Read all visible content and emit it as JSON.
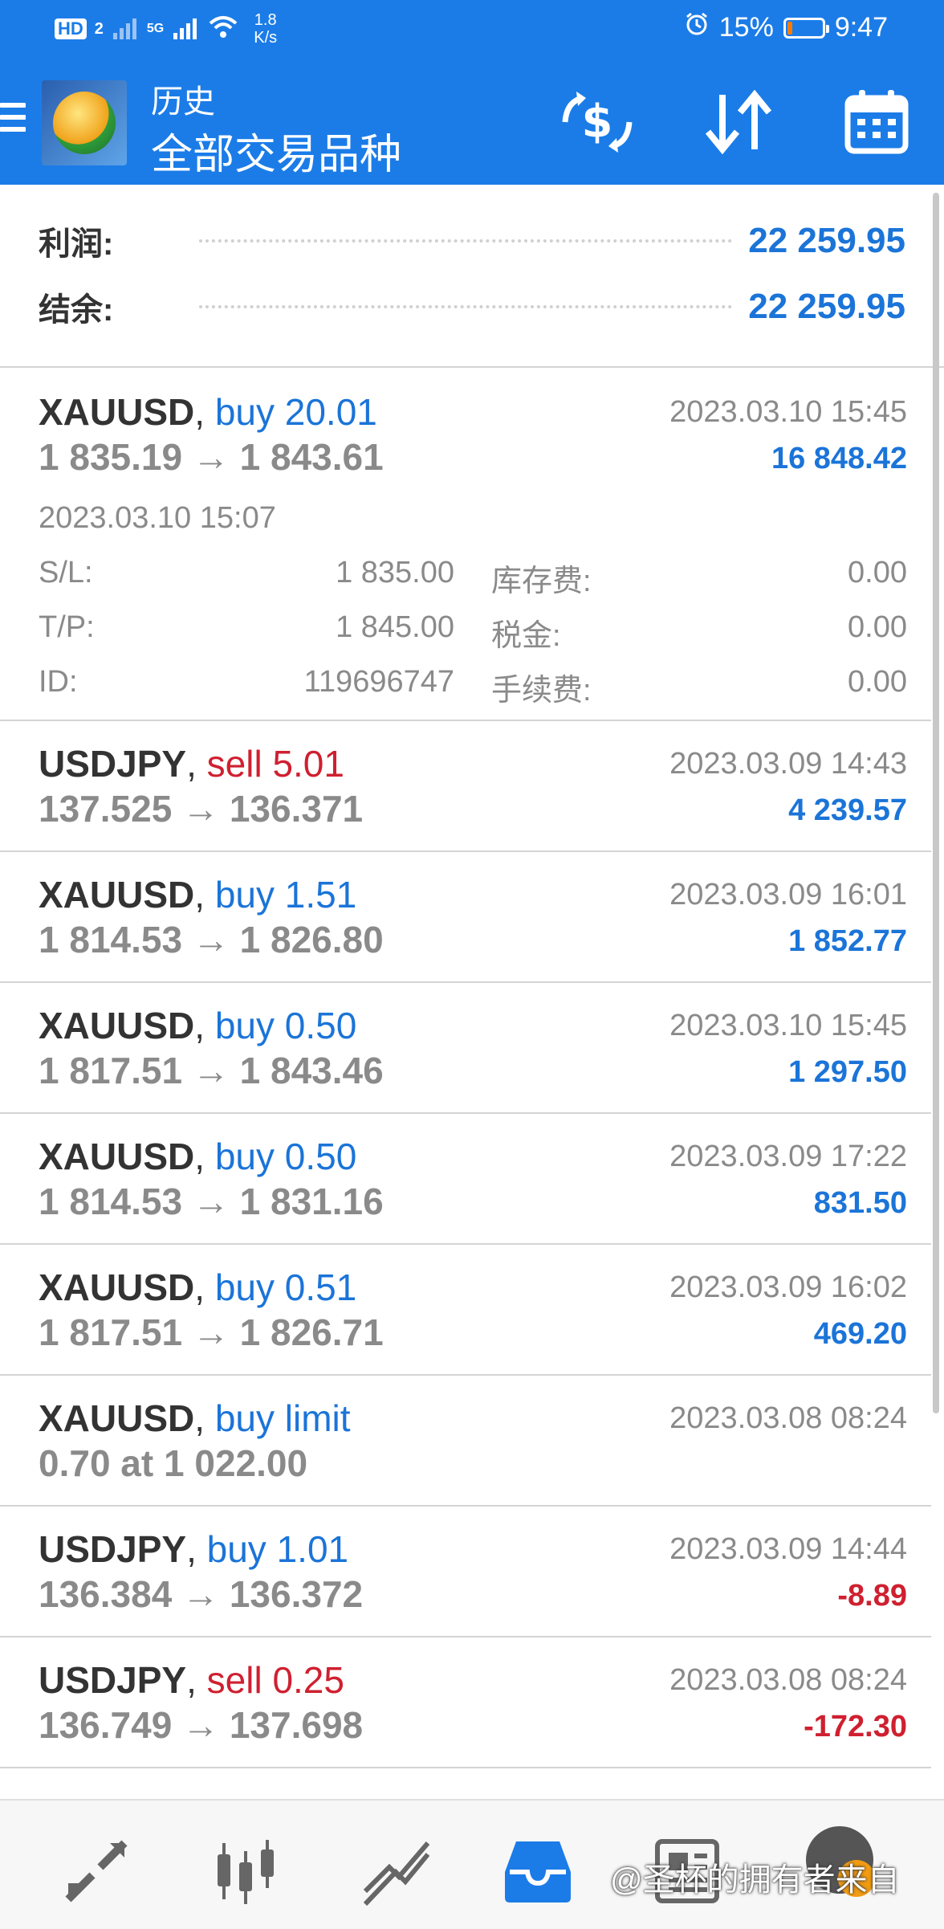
{
  "status_bar": {
    "hd_label": "HD",
    "sim_slot": "2",
    "network": "5G",
    "speed_value": "1.8",
    "speed_unit": "K/s",
    "battery": "15%",
    "battery_level": 0.15,
    "battery_color": "#ff7b00",
    "time": "9:47"
  },
  "app_bar": {
    "title_top": "历史",
    "title_main": "全部交易品种",
    "icons": [
      "hamburger-menu-icon",
      "metatrader-logo",
      "dollar-exchange-icon",
      "sort-icon",
      "calendar-icon"
    ]
  },
  "summary": {
    "profit_label": "利润:",
    "profit_value": "22 259.95",
    "balance_label": "结余:",
    "balance_value": "22 259.95"
  },
  "expanded": {
    "open_time": "2023.03.10 15:07",
    "sl_label": "S/L:",
    "sl_value": "1 835.00",
    "tp_label": "T/P:",
    "tp_value": "1 845.00",
    "id_label": "ID:",
    "id_value": "119696747",
    "swap_label": "库存费:",
    "swap_value": "0.00",
    "tax_label": "税金:",
    "tax_value": "0.00",
    "fee_label": "手续费:",
    "fee_value": "0.00"
  },
  "trades": [
    {
      "symbol": "XAUUSD",
      "side": "buy 20.01",
      "prices": "1 835.19 → 1 843.61",
      "date": "2023.03.10 15:45",
      "profit": "16 848.42"
    },
    {
      "symbol": "USDJPY",
      "side": "sell 5.01",
      "prices": "137.525 → 136.371",
      "date": "2023.03.09 14:43",
      "profit": "4 239.57"
    },
    {
      "symbol": "XAUUSD",
      "side": "buy 1.51",
      "prices": "1 814.53 → 1 826.80",
      "date": "2023.03.09 16:01",
      "profit": "1 852.77"
    },
    {
      "symbol": "XAUUSD",
      "side": "buy 0.50",
      "prices": "1 817.51 → 1 843.46",
      "date": "2023.03.10 15:45",
      "profit": "1 297.50"
    },
    {
      "symbol": "XAUUSD",
      "side": "buy 0.50",
      "prices": "1 814.53 → 1 831.16",
      "date": "2023.03.09 17:22",
      "profit": "831.50"
    },
    {
      "symbol": "XAUUSD",
      "side": "buy 0.51",
      "prices": "1 817.51 → 1 826.71",
      "date": "2023.03.09 16:02",
      "profit": "469.20"
    },
    {
      "symbol": "XAUUSD",
      "side": "buy limit",
      "prices": "0.70 at 1 022.00",
      "date": "2023.03.08 08:24",
      "profit": ""
    },
    {
      "symbol": "USDJPY",
      "side": "buy 1.01",
      "prices": "136.384 → 136.372",
      "date": "2023.03.09 14:44",
      "profit": "-8.89"
    },
    {
      "symbol": "USDJPY",
      "side": "sell 0.25",
      "prices": "136.749 → 137.698",
      "date": "2023.03.08 08:24",
      "profit": "-172.30"
    }
  ],
  "bottom_nav": {
    "icons": [
      "quotes-icon",
      "chart-icon",
      "trade-icon",
      "history-icon",
      "news-icon"
    ],
    "active": "history-icon"
  },
  "watermark": "@圣杯的拥有者来自",
  "colors": {
    "primary": "#1b7ce8",
    "buy_blue": "#1b74d8",
    "sell_red": "#cf2030",
    "muted": "#8a8a8a"
  }
}
